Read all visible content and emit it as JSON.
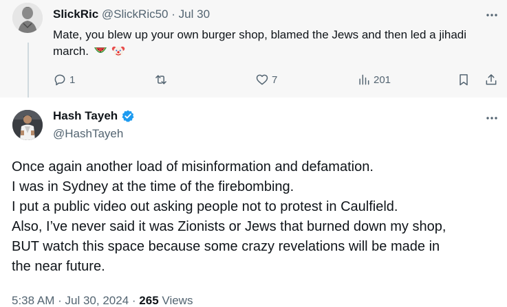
{
  "reply": {
    "display_name": "SlickRic",
    "handle": "@SlickRic50",
    "separator": "·",
    "date": "Jul 30",
    "text": "Mate, you blew up your own burger shop, blamed the Jews and then led a jihadi march.",
    "emojis": [
      "watermelon-emoji",
      "clown-face-emoji"
    ],
    "actions": {
      "replies": "1",
      "reposts": "",
      "likes": "7",
      "views": "201"
    }
  },
  "main": {
    "display_name": "Hash Tayeh",
    "verified": true,
    "handle": "@HashTayeh",
    "lines": [
      "Once again another load of misinformation and defamation.",
      "I was in Sydney at the time of the firebombing.",
      "I put a public video out asking people not to protest in Caulfield.",
      "Also, I’ve never said it was Zionists or Jews that burned down my shop,",
      "BUT watch this space because some crazy revelations will be made in",
      "the near future."
    ],
    "time": "5:38 AM",
    "separator": "·",
    "date": "Jul 30, 2024",
    "views_count": "265",
    "views_label": "Views"
  },
  "colors": {
    "text_primary": "#0f1419",
    "text_secondary": "#536471",
    "verified_blue": "#1d9bf0",
    "reply_background": "#f7f7f7",
    "thread_line": "#cfd9de"
  }
}
